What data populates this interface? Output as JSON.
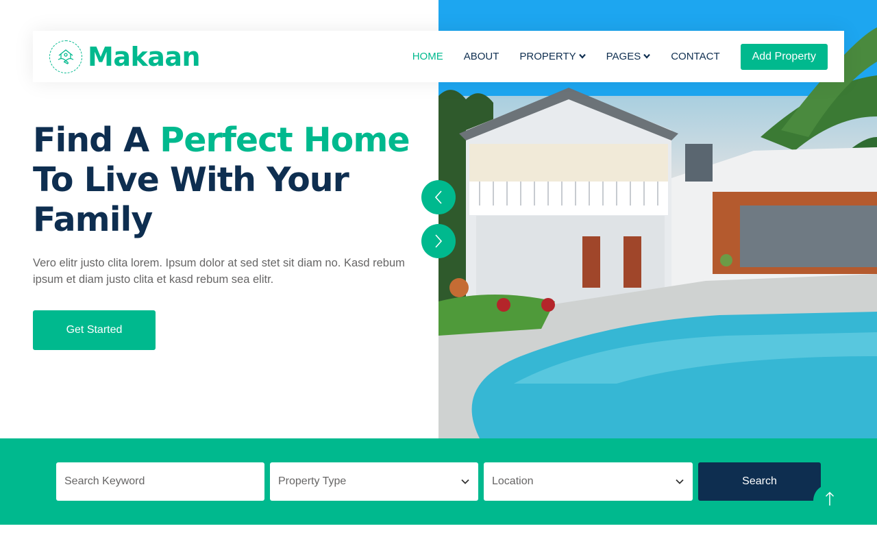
{
  "brand": {
    "name": "Makaan",
    "icon": "house-handshake-icon"
  },
  "nav": {
    "items": [
      {
        "label": "HOME",
        "active": true
      },
      {
        "label": "ABOUT"
      },
      {
        "label": "PROPERTY",
        "dropdown": true
      },
      {
        "label": "PAGES",
        "dropdown": true
      },
      {
        "label": "CONTACT"
      }
    ],
    "cta": "Add Property"
  },
  "hero": {
    "title_part1": "Find A ",
    "title_accent": "Perfect Home",
    "title_part2": "To Live With Your Family",
    "description": "Vero elitr justo clita lorem. Ipsum dolor at sed stet sit diam no. Kasd rebum ipsum et diam justo clita et kasd rebum sea elitr.",
    "cta": "Get Started",
    "image": "house-with-pool-photo"
  },
  "carousel": {
    "prev_icon": "chevron-left-icon",
    "next_icon": "chevron-right-icon"
  },
  "search": {
    "keyword_placeholder": "Search Keyword",
    "property_type": "Property Type",
    "location": "Location",
    "button": "Search"
  },
  "back_to_top_icon": "arrow-up-icon",
  "colors": {
    "primary": "#00b98e",
    "dark": "#0e2e50",
    "text": "#666565"
  }
}
